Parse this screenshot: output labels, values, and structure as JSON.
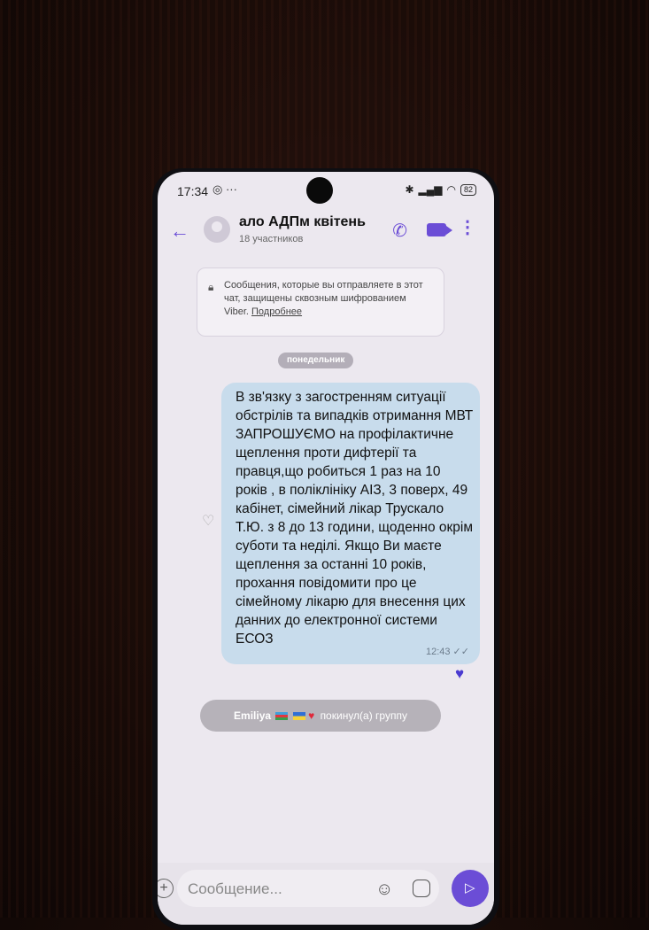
{
  "status": {
    "time": "17:34",
    "extra": "◎ ···",
    "battery": "82"
  },
  "header": {
    "title": "ало АДПм квітень",
    "subtitle": "18 участников"
  },
  "notice": {
    "text": "Сообщения, которые вы отправляете в этот чат, защищены сквозным шифрованием Viber.",
    "link": "Подробнее"
  },
  "day_label": "понедельник",
  "message": {
    "text": "В зв'язку з загостренням ситуації обстрілів та випадків отримання МВТ ЗАПРОШУЄМО на профілактичне щеплення проти дифтерії та правця,що робиться 1 раз на 10 років , в поліклініку АІЗ, 3 поверх, 49 кабінет, сімейний лікар Трускало Т.Ю. з 8 до 13 години, щоденно окрім суботи та неділі. Якщо Ви маєте щеплення за останні 10 років, прохання повідомити про це сімейному лікарю для внесення цих данних до електронної системи ЕСОЗ",
    "time": "12:43 ✓✓"
  },
  "system_message": {
    "name": "Emiliya",
    "text": "покинул(а) группу"
  },
  "composer": {
    "placeholder": "Сообщение..."
  },
  "colors": {
    "accent": "#6b4dd6",
    "bubble": "#c8dcec"
  }
}
